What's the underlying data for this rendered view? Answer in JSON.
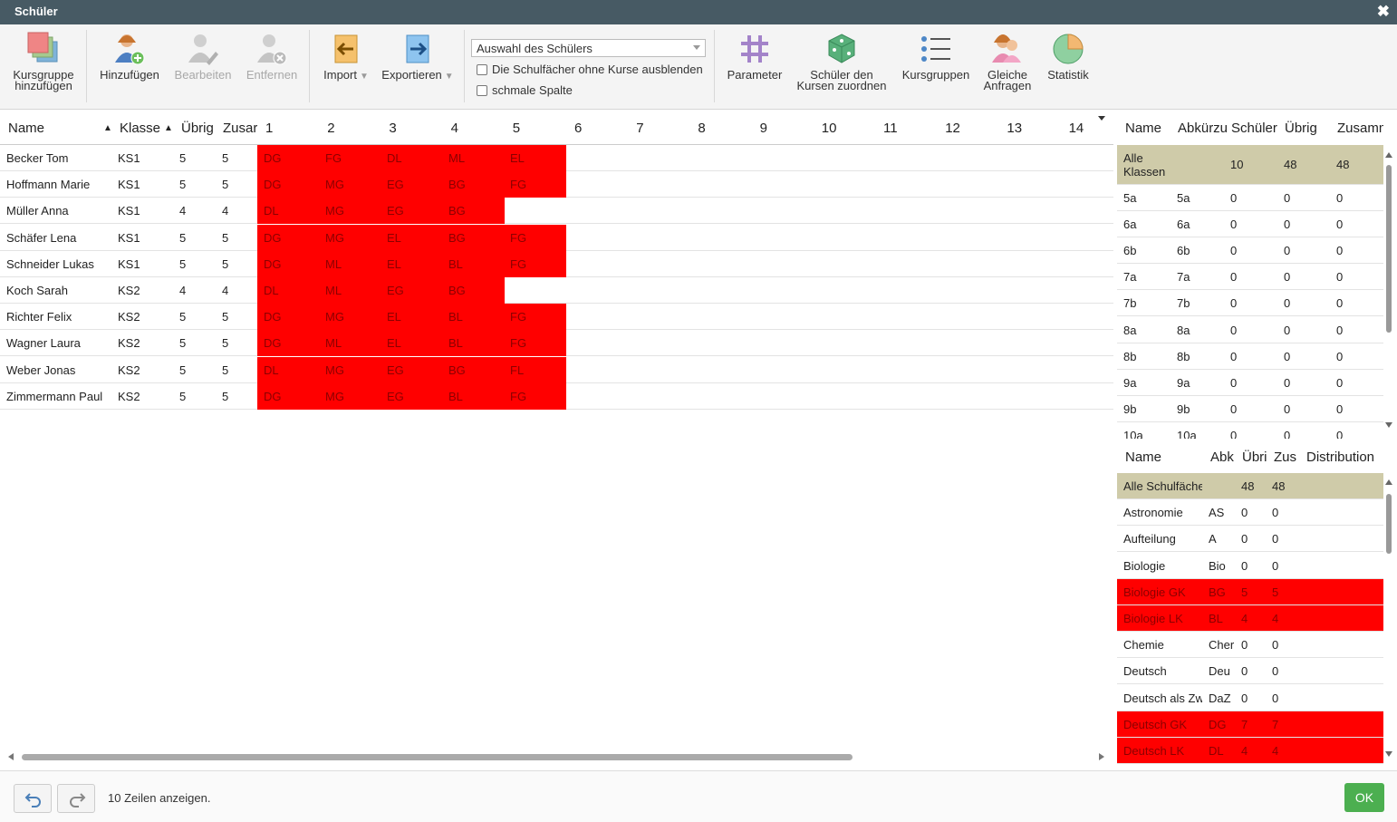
{
  "window": {
    "title": "Schüler",
    "close_glyph": "✖"
  },
  "toolbar": {
    "kursgruppe": "Kursgruppe hinzufügen",
    "hinzufuegen": "Hinzufügen",
    "bearbeiten": "Bearbeiten",
    "entfernen": "Entfernen",
    "import": "Import",
    "exportieren": "Exportieren",
    "dropdown_arrow": "▼",
    "select_value": "Auswahl des Schülers",
    "hide_subjects": "Die Schulfächer ohne Kurse ausblenden",
    "narrow_column": "schmale Spalte",
    "parameter": "Parameter",
    "assign": "Schüler den Kursen zuordnen",
    "kursgruppen": "Kursgruppen",
    "gleiche": "Gleiche Anfragen",
    "statistik": "Statistik"
  },
  "main_grid": {
    "headers": {
      "name": "Name",
      "klasse": "Klasse",
      "uebrig": "Übrig",
      "zusammen": "Zusar",
      "sort_glyph": "▲"
    },
    "slots": [
      "1",
      "2",
      "3",
      "4",
      "5",
      "6",
      "7",
      "8",
      "9",
      "10",
      "11",
      "12",
      "13",
      "14"
    ],
    "rows": [
      {
        "name": "Becker Tom",
        "klasse": "KS1",
        "uebrig": "5",
        "zus": "5",
        "courses": [
          "DG",
          "FG",
          "DL",
          "ML",
          "EL"
        ]
      },
      {
        "name": "Hoffmann Marie",
        "klasse": "KS1",
        "uebrig": "5",
        "zus": "5",
        "courses": [
          "DG",
          "MG",
          "EG",
          "BG",
          "FG"
        ]
      },
      {
        "name": "Müller Anna",
        "klasse": "KS1",
        "uebrig": "4",
        "zus": "4",
        "courses": [
          "DL",
          "MG",
          "EG",
          "BG"
        ]
      },
      {
        "name": "Schäfer Lena",
        "klasse": "KS1",
        "uebrig": "5",
        "zus": "5",
        "courses": [
          "DG",
          "MG",
          "EL",
          "BG",
          "FG"
        ]
      },
      {
        "name": "Schneider Lukas",
        "klasse": "KS1",
        "uebrig": "5",
        "zus": "5",
        "courses": [
          "DG",
          "ML",
          "EL",
          "BL",
          "FG"
        ]
      },
      {
        "name": "Koch Sarah",
        "klasse": "KS2",
        "uebrig": "4",
        "zus": "4",
        "courses": [
          "DL",
          "ML",
          "EG",
          "BG"
        ]
      },
      {
        "name": "Richter Felix",
        "klasse": "KS2",
        "uebrig": "5",
        "zus": "5",
        "courses": [
          "DG",
          "MG",
          "EL",
          "BL",
          "FG"
        ]
      },
      {
        "name": "Wagner Laura",
        "klasse": "KS2",
        "uebrig": "5",
        "zus": "5",
        "courses": [
          "DG",
          "ML",
          "EL",
          "BL",
          "FG"
        ]
      },
      {
        "name": "Weber Jonas",
        "klasse": "KS2",
        "uebrig": "5",
        "zus": "5",
        "courses": [
          "DL",
          "MG",
          "EG",
          "BG",
          "FL"
        ]
      },
      {
        "name": "Zimmermann Paul",
        "klasse": "KS2",
        "uebrig": "5",
        "zus": "5",
        "courses": [
          "DG",
          "MG",
          "EG",
          "BL",
          "FG"
        ]
      }
    ]
  },
  "classes_panel": {
    "headers": {
      "name": "Name",
      "abk": "Abkürzu",
      "schueler": "Schüler",
      "uebrig": "Übrig",
      "zus": "Zusamm"
    },
    "rows": [
      {
        "name": "Alle Klassen",
        "abk": "",
        "schueler": "10",
        "uebrig": "48",
        "zus": "48",
        "sum": true
      },
      {
        "name": "5a",
        "abk": "5a",
        "schueler": "0",
        "uebrig": "0",
        "zus": "0"
      },
      {
        "name": "6a",
        "abk": "6a",
        "schueler": "0",
        "uebrig": "0",
        "zus": "0"
      },
      {
        "name": "6b",
        "abk": "6b",
        "schueler": "0",
        "uebrig": "0",
        "zus": "0"
      },
      {
        "name": "7a",
        "abk": "7a",
        "schueler": "0",
        "uebrig": "0",
        "zus": "0"
      },
      {
        "name": "7b",
        "abk": "7b",
        "schueler": "0",
        "uebrig": "0",
        "zus": "0"
      },
      {
        "name": "8a",
        "abk": "8a",
        "schueler": "0",
        "uebrig": "0",
        "zus": "0"
      },
      {
        "name": "8b",
        "abk": "8b",
        "schueler": "0",
        "uebrig": "0",
        "zus": "0"
      },
      {
        "name": "9a",
        "abk": "9a",
        "schueler": "0",
        "uebrig": "0",
        "zus": "0"
      },
      {
        "name": "9b",
        "abk": "9b",
        "schueler": "0",
        "uebrig": "0",
        "zus": "0"
      },
      {
        "name": "10a",
        "abk": "10a",
        "schueler": "0",
        "uebrig": "0",
        "zus": "0"
      }
    ]
  },
  "subjects_panel": {
    "headers": {
      "name": "Name",
      "abk": "Abk",
      "uebrig": "Übri",
      "zus": "Zus",
      "dist": "Distribution"
    },
    "rows": [
      {
        "name": "Alle Schulfächer",
        "abk": "",
        "uebrig": "48",
        "zus": "48",
        "kind": "sum"
      },
      {
        "name": "Astronomie",
        "abk": "AS",
        "uebrig": "0",
        "zus": "0",
        "kind": ""
      },
      {
        "name": "Aufteilung",
        "abk": "A",
        "uebrig": "0",
        "zus": "0",
        "kind": ""
      },
      {
        "name": "Biologie",
        "abk": "Bio",
        "uebrig": "0",
        "zus": "0",
        "kind": ""
      },
      {
        "name": "Biologie GK",
        "abk": "BG",
        "uebrig": "5",
        "zus": "5",
        "kind": "hot"
      },
      {
        "name": "Biologie LK",
        "abk": "BL",
        "uebrig": "4",
        "zus": "4",
        "kind": "hot"
      },
      {
        "name": "Chemie",
        "abk": "Cher",
        "uebrig": "0",
        "zus": "0",
        "kind": ""
      },
      {
        "name": "Deutsch",
        "abk": "Deu",
        "uebrig": "0",
        "zus": "0",
        "kind": ""
      },
      {
        "name": "Deutsch als Zweitsprache",
        "abk": "DaZ",
        "uebrig": "0",
        "zus": "0",
        "kind": ""
      },
      {
        "name": "Deutsch GK",
        "abk": "DG",
        "uebrig": "7",
        "zus": "7",
        "kind": "hot"
      },
      {
        "name": "Deutsch LK",
        "abk": "DL",
        "uebrig": "4",
        "zus": "4",
        "kind": "hot"
      }
    ]
  },
  "footer": {
    "info": "10 Zeilen anzeigen.",
    "ok": "OK"
  },
  "colors": {
    "titlebar": "#475a64",
    "highlight": "#ff0000",
    "summary": "#cfcba9",
    "ok": "#4caf50"
  }
}
